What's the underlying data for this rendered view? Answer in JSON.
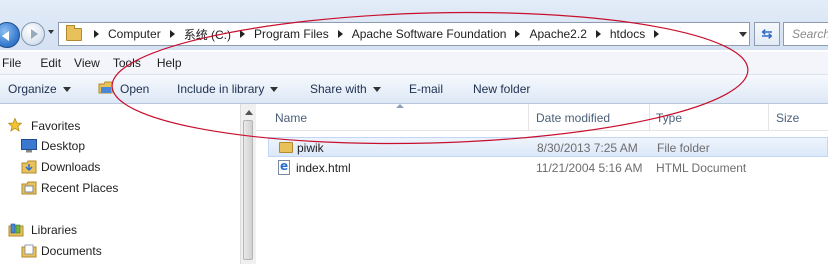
{
  "window": {
    "accent": "#3b7fd1",
    "annotation_color": "#c8102e"
  },
  "address_bar": {
    "breadcrumbs": [
      "Computer",
      "系统 (C:)",
      "Program Files",
      "Apache Software Foundation",
      "Apache2.2",
      "htdocs"
    ],
    "search_placeholder": "Search"
  },
  "menu": {
    "items": [
      "File",
      "Edit",
      "View",
      "Tools",
      "Help"
    ]
  },
  "toolbar": {
    "organize": "Organize",
    "open": "Open",
    "include_in_library": "Include in library",
    "share_with": "Share with",
    "email": "E-mail",
    "new_folder": "New folder"
  },
  "nav_pane": {
    "favorites_label": "Favorites",
    "favorites": [
      "Desktop",
      "Downloads",
      "Recent Places"
    ],
    "libraries_label": "Libraries",
    "libraries": [
      "Documents"
    ]
  },
  "file_list": {
    "columns": [
      "Name",
      "Date modified",
      "Type",
      "Size"
    ],
    "rows": [
      {
        "name": "piwik",
        "date": "8/30/2013 7:25 AM",
        "type": "File folder",
        "icon": "folder-icon",
        "selected": true
      },
      {
        "name": "index.html",
        "date": "11/21/2004 5:16 AM",
        "type": "HTML Document",
        "icon": "html-document-icon",
        "selected": false
      }
    ]
  }
}
